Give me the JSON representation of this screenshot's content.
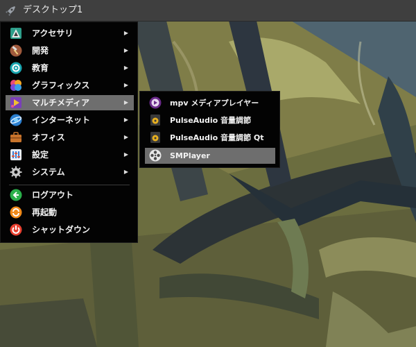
{
  "panel": {
    "title": "デスクトップ1",
    "launcher_icon": "rocket-icon"
  },
  "menu": {
    "items": [
      {
        "label": "アクセサリ",
        "icon": "accessories-icon",
        "has_submenu": true
      },
      {
        "label": "開発",
        "icon": "development-hammer-icon",
        "has_submenu": true
      },
      {
        "label": "教育",
        "icon": "education-icon",
        "has_submenu": true
      },
      {
        "label": "グラフィックス",
        "icon": "graphics-icon",
        "has_submenu": true
      },
      {
        "label": "マルチメディア",
        "icon": "multimedia-icon",
        "has_submenu": true,
        "active": true
      },
      {
        "label": "インターネット",
        "icon": "internet-icon",
        "has_submenu": true
      },
      {
        "label": "オフィス",
        "icon": "office-briefcase-icon",
        "has_submenu": true
      },
      {
        "label": "設定",
        "icon": "settings-icon",
        "has_submenu": true
      },
      {
        "label": "システム",
        "icon": "system-gear-icon",
        "has_submenu": true
      }
    ],
    "session_items": [
      {
        "label": "ログアウト",
        "icon": "logout-icon"
      },
      {
        "label": "再起動",
        "icon": "restart-icon"
      },
      {
        "label": "シャットダウン",
        "icon": "shutdown-icon"
      }
    ],
    "submenu_arrow": "▶"
  },
  "submenu": {
    "items": [
      {
        "label": "mpv メディアプレイヤー",
        "icon": "mpv-icon"
      },
      {
        "label": "PulseAudio 音量調節",
        "icon": "speaker-icon"
      },
      {
        "label": "PulseAudio 音量調節 Qt",
        "icon": "speaker-icon"
      },
      {
        "label": "SMPlayer",
        "icon": "smplayer-icon",
        "active": true
      }
    ]
  },
  "colors": {
    "panel_bg": "#3f3f3f",
    "menu_bg": "#030303",
    "highlight": "#6e6e6e",
    "text": "#f2f2f2"
  }
}
